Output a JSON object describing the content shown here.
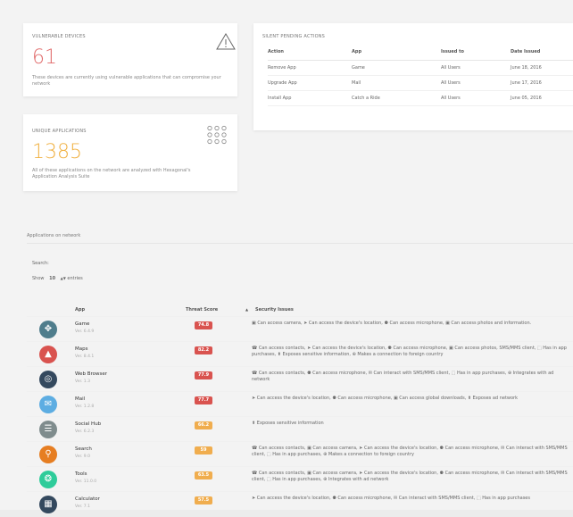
{
  "vulnerable": {
    "title": "VULNERABLE DEVICES",
    "count": "61",
    "description": "These devices are currently using vulnerable applications that can compromise your network",
    "icon": "warning-triangle-icon",
    "color": "#e06a6a"
  },
  "unique": {
    "title": "UNIQUE APPLICATIONS",
    "count": "1385",
    "description": "All of these applications on the network are analyzed with Hexagonal's Application Analysis Suite",
    "icon": "apps-grid-icon",
    "color": "#f0b040"
  },
  "pending": {
    "title": "SILENT PENDING ACTIONS",
    "columns": [
      "Action",
      "App",
      "Issued to",
      "Date Issued"
    ],
    "rows": [
      [
        "Remove App",
        "Game",
        "All Users",
        "June 18, 2016"
      ],
      [
        "Upgrade App",
        "Mail",
        "All Users",
        "June 17, 2016"
      ],
      [
        "Install App",
        "Catch a Ride",
        "All Users",
        "June 05, 2016"
      ]
    ]
  },
  "apps": {
    "heading": "Applications on network",
    "search_label": "Search:",
    "show_label": "Show",
    "show_value": "10",
    "entries_label": "entries",
    "columns": {
      "app": "App",
      "threat": "Threat Score",
      "issues": "Security Issues"
    },
    "rows": [
      {
        "name": "Game",
        "version": "Ver. 6.4.9",
        "score": "74.8",
        "badge_color": "#d9534f",
        "icon": "gamepad-icon",
        "icon_color": "#4f7d8c",
        "issues": "▣ Can access camera, ➤ Can access the device's location, ⚉ Can access microphone, ▣ Can access photos and information."
      },
      {
        "name": "Maps",
        "version": "Ver. 8.4.1",
        "score": "82.2",
        "badge_color": "#d9534f",
        "icon": "navigation-icon",
        "icon_color": "#d9534f",
        "issues": "☎ Can access contacts, ➤ Can access the device's location, ⚉ Can access microphone, ▣ Can access photos, SMS/MMS client, ⬚ Has in app purchases, ⬆ Exposes sensitive information, ⊕ Makes a connection to foreign country"
      },
      {
        "name": "Web Browser",
        "version": "Ver. 1.3",
        "score": "77.9",
        "badge_color": "#d9534f",
        "icon": "globe-icon",
        "icon_color": "#34495e",
        "issues": "☎ Can access contacts, ⚉ Can access microphone, ✉ Can interact with SMS/MMS client, ⬚ Has in app purchases, ⊕ Integrates with ad network"
      },
      {
        "name": "Mail",
        "version": "Ver. 1.2.8",
        "score": "77.7",
        "badge_color": "#d9534f",
        "icon": "mail-icon",
        "icon_color": "#5dade2",
        "issues": "➤ Can access the device's location, ⚉ Can access microphone, ▣ Can access global downloads, ⬆ Exposes ad network"
      },
      {
        "name": "Social Hub",
        "version": "Ver. 6.2.3",
        "score": "66.2",
        "badge_color": "#f0ad4e",
        "icon": "layers-icon",
        "icon_color": "#7f8c8d",
        "issues": "⬆ Exposes sensitive information"
      },
      {
        "name": "Search",
        "version": "Ver. 9.0",
        "score": "59",
        "badge_color": "#f0ad4e",
        "icon": "search-icon",
        "icon_color": "#e67e22",
        "issues": "☎ Can access contacts, ▣ Can access camera, ➤ Can access the device's location, ⚉ Can access microphone, ✉ Can interact with SMS/MMS client, ⬚ Has in app purchases, ⊕ Makes a connection to foreign country"
      },
      {
        "name": "Tools",
        "version": "Ver. 11.0.0",
        "score": "63.5",
        "badge_color": "#f0ad4e",
        "icon": "gear-icon",
        "icon_color": "#2ecc9a",
        "issues": "☎ Can access contacts, ▣ Can access camera, ➤ Can access the device's location, ⚉ Can access microphone, ✉ Can interact with SMS/MMS client, ⬚ Has in app purchases, ⊕ Integrates with ad network"
      },
      {
        "name": "Calculator",
        "version": "Ver. 7.1",
        "score": "57.5",
        "badge_color": "#f0ad4e",
        "icon": "calculator-icon",
        "icon_color": "#34495e",
        "issues": "➤ Can access the device's location, ⚉ Can access microphone, ✉ Can interact with SMS/MMS client, ⬚ Has in app purchases"
      }
    ]
  }
}
